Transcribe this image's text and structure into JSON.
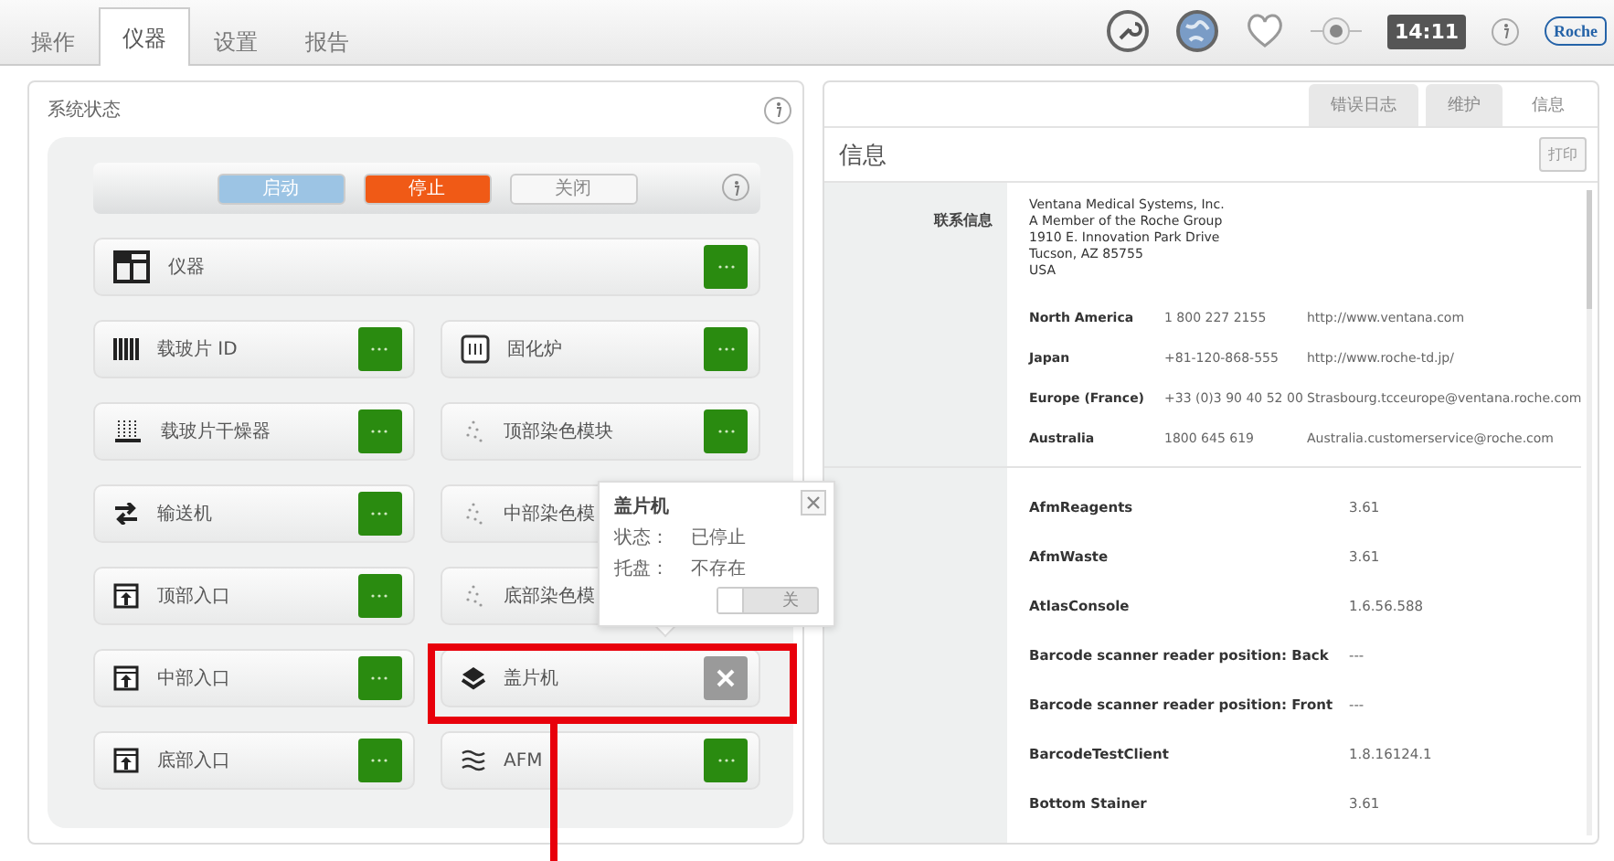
{
  "main_tabs": [
    {
      "label": "操作",
      "selected": false
    },
    {
      "label": "仪器",
      "selected": true
    },
    {
      "label": "设置",
      "selected": false
    },
    {
      "label": "报告",
      "selected": false
    }
  ],
  "top_bar": {
    "time": "14:11",
    "logo": "Roche"
  },
  "system_panel": {
    "title": "系统状态",
    "controls": [
      {
        "label": "启动",
        "kind": "start"
      },
      {
        "label": "停止",
        "kind": "stop"
      },
      {
        "label": "关闭",
        "kind": "off"
      }
    ],
    "instrument": {
      "label": "仪器",
      "kind": "window",
      "error": false
    },
    "modules": [
      {
        "label": "载玻片 ID",
        "kind": "barcode",
        "error": false
      },
      {
        "label": "固化炉",
        "kind": "oven",
        "error": false
      },
      {
        "label": "载玻片干燥器",
        "kind": "dryer",
        "error": false
      },
      {
        "label": "顶部染色模块",
        "kind": "stainer",
        "error": false
      },
      {
        "label": "输送机",
        "kind": "transfer",
        "error": false
      },
      {
        "label": "中部染色模",
        "kind": "stainer"
      },
      {
        "label": "顶部入口",
        "kind": "entry",
        "error": false
      },
      {
        "label": "底部染色模",
        "kind": "stainer"
      },
      {
        "label": "中部入口",
        "kind": "entry",
        "error": false
      },
      {
        "label": "盖片机",
        "kind": "layers",
        "error": true
      },
      {
        "label": "底部入口",
        "kind": "entry",
        "error": false
      },
      {
        "label": "AFM",
        "kind": "waves",
        "error": false
      }
    ],
    "popup": {
      "title": "盖片机",
      "fields": [
        {
          "label": "状态：",
          "value": "已停止"
        },
        {
          "label": "托盘：",
          "value": "不存在"
        }
      ],
      "toggle": {
        "label": "关",
        "on": false
      }
    }
  },
  "info_panel": {
    "tabs": [
      {
        "label": "错误日志",
        "selected": false
      },
      {
        "label": "维护",
        "selected": false
      },
      {
        "label": "信息",
        "selected": true
      }
    ],
    "title": "信息",
    "print_button": "打印",
    "contact_label": "联系信息",
    "address": [
      "Ventana Medical Systems, Inc.",
      "A Member of the Roche Group",
      "1910 E. Innovation Park Drive",
      "Tucson, AZ 85755",
      "USA"
    ],
    "contacts": [
      {
        "region": "North America",
        "phone": "1 800 227 2155",
        "web": "http://www.ventana.com"
      },
      {
        "region": "Japan",
        "phone": "+81-120-868-555",
        "web": "http://www.roche-td.jp/"
      },
      {
        "region": "Europe (France)",
        "phone": "+33 (0)3 90 40 52 00",
        "web": "Strasbourg.tcceurope@ventana.roche.com"
      },
      {
        "region": "Australia",
        "phone": "1800 645 619",
        "web": "Australia.customerservice@roche.com"
      }
    ],
    "versions": [
      {
        "name": "AfmReagents",
        "version": "3.61"
      },
      {
        "name": "AfmWaste",
        "version": "3.61"
      },
      {
        "name": "AtlasConsole",
        "version": "1.6.56.588"
      },
      {
        "name": "Barcode scanner reader position: Back",
        "version": "---"
      },
      {
        "name": "Barcode scanner reader position: Front",
        "version": "---"
      },
      {
        "name": "BarcodeTestClient",
        "version": "1.8.16124.1"
      },
      {
        "name": "Bottom Stainer",
        "version": "3.61"
      }
    ]
  }
}
